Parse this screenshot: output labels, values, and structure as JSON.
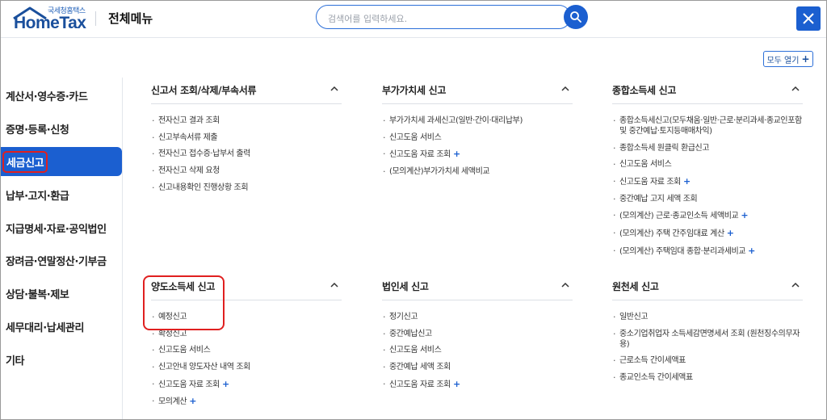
{
  "header": {
    "logo_small": "국세청홈택스",
    "logo_main": "HomeTax",
    "title": "전체메뉴",
    "search_placeholder": "검색어를 입력하세요."
  },
  "expand_all_label": "모두 열기",
  "sidebar": {
    "items": [
      {
        "label": "계산서·영수증·카드",
        "active": false
      },
      {
        "label": "증명·등록·신청",
        "active": false
      },
      {
        "label": "세금신고",
        "active": true
      },
      {
        "label": "납부·고지·환급",
        "active": false
      },
      {
        "label": "지급명세·자료·공익법인",
        "active": false
      },
      {
        "label": "장려금·연말정산·기부금",
        "active": false
      },
      {
        "label": "상담·불복·제보",
        "active": false
      },
      {
        "label": "세무대리·납세관리",
        "active": false
      },
      {
        "label": "기타",
        "active": false
      }
    ]
  },
  "panels": [
    {
      "title": "신고서 조회/삭제/부속서류",
      "items": [
        {
          "label": "전자신고 결과 조회",
          "plus": false
        },
        {
          "label": "신고부속서류 제출",
          "plus": false
        },
        {
          "label": "전자신고 접수증·납부서 출력",
          "plus": false
        },
        {
          "label": "전자신고 삭제 요청",
          "plus": false
        },
        {
          "label": "신고내용확인 진행상황 조회",
          "plus": false
        }
      ]
    },
    {
      "title": "부가가치세 신고",
      "items": [
        {
          "label": "부가가치세 과세신고(일반·간이·대리납부)",
          "plus": false
        },
        {
          "label": "신고도움 서비스",
          "plus": false
        },
        {
          "label": "신고도움 자료 조회",
          "plus": true
        },
        {
          "label": "(모의계산)부가가치세 세액비교",
          "plus": false
        }
      ]
    },
    {
      "title": "종합소득세 신고",
      "items": [
        {
          "label": "종합소득세신고(모두채움·일반·근로·분리과세·종교인포함 및 중간예납·토지등매매차익)",
          "plus": false
        },
        {
          "label": "종합소득세 원클릭 환급신고",
          "plus": false
        },
        {
          "label": "신고도움 서비스",
          "plus": false
        },
        {
          "label": "신고도움 자료 조회",
          "plus": true
        },
        {
          "label": "중간예납 고지 세액 조회",
          "plus": false
        },
        {
          "label": "(모의계산) 근로·종교인소득 세액비교",
          "plus": true
        },
        {
          "label": "(모의계산) 주택 간주임대료 계산",
          "plus": true
        },
        {
          "label": "(모의계산) 주택임대 종합·분리과세비교",
          "plus": true
        }
      ]
    },
    {
      "title": "양도소득세 신고",
      "items": [
        {
          "label": "예정신고",
          "plus": false
        },
        {
          "label": "확정신고",
          "plus": false
        },
        {
          "label": "신고도움 서비스",
          "plus": false
        },
        {
          "label": "신고안내 양도자산 내역 조회",
          "plus": false
        },
        {
          "label": "신고도움 자료 조회",
          "plus": true
        },
        {
          "label": "모의계산",
          "plus": true
        }
      ]
    },
    {
      "title": "법인세 신고",
      "items": [
        {
          "label": "정기신고",
          "plus": false
        },
        {
          "label": "중간예납신고",
          "plus": false
        },
        {
          "label": "신고도움 서비스",
          "plus": false
        },
        {
          "label": "중간예납 세액 조회",
          "plus": false
        },
        {
          "label": "신고도움 자료 조회",
          "plus": true
        }
      ]
    },
    {
      "title": "원천세 신고",
      "items": [
        {
          "label": "일반신고",
          "plus": false
        },
        {
          "label": "중소기업취업자 소득세감면명세서 조회 (원천징수의무자용)",
          "plus": false
        },
        {
          "label": "근로소득 간이세액표",
          "plus": false
        },
        {
          "label": "종교인소득 간이세액표",
          "plus": false
        }
      ]
    }
  ],
  "colors": {
    "brand_blue": "#1b5fd0",
    "highlight_red": "#e02020"
  },
  "icons": {
    "search": "search-icon",
    "close": "close-icon",
    "collapse": "chevron-up-icon",
    "add": "plus-icon"
  }
}
